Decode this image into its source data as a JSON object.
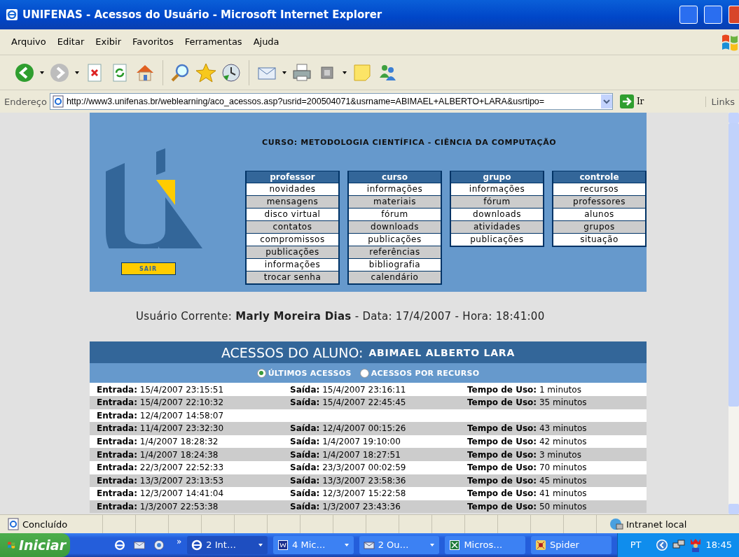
{
  "window": {
    "title": "UNIFENAS - Acessos do Usuário - Microsoft Internet Explorer"
  },
  "menu": [
    "Arquivo",
    "Editar",
    "Exibir",
    "Favoritos",
    "Ferramentas",
    "Ajuda"
  ],
  "address": {
    "label": "Endereço",
    "url": "http://www3.unifenas.br/weblearning/aco_acessos.asp?usrid=200504071&usrname=ABIMAEL+ALBERTO+LARA&usrtipo=",
    "go": "Ir",
    "links": "Links"
  },
  "banner": {
    "course": "CURSO: METODOLOGIA CIENTÍFICA - CIÊNCIA DA COMPUTAÇÃO",
    "exit": "SAIR",
    "menus": [
      {
        "title": "professor",
        "items": [
          "novidades",
          "mensagens",
          "disco virtual",
          "contatos",
          "compromissos",
          "publicações",
          "informações",
          "trocar senha"
        ]
      },
      {
        "title": "curso",
        "items": [
          "informações",
          "materiais",
          "fórum",
          "downloads",
          "publicações",
          "referências",
          "bibliografia",
          "calendário"
        ]
      },
      {
        "title": "grupo",
        "items": [
          "informações",
          "fórum",
          "downloads",
          "atividades",
          "publicações"
        ]
      },
      {
        "title": "controle",
        "items": [
          "recursos",
          "professores",
          "alunos",
          "grupos",
          "situação"
        ]
      }
    ]
  },
  "current_user": "Usuário Corrente: **Marly Moreira Dias** - Data: 17/4/2007 - Hora: 18:41:00",
  "access": {
    "title": "ACESSOS DO ALUNO:",
    "student": "ABIMAEL ALBERTO LARA",
    "radios": [
      {
        "label": "ÚLTIMOS ACESSOS",
        "selected": true
      },
      {
        "label": "ACESSOS POR RECURSO",
        "selected": false
      }
    ],
    "rows": [
      {
        "entrada": "**Entrada:** 15/4/2007 23:15:51",
        "saida": "**Saída:** 15/4/2007 23:16:11",
        "tempo": "**Tempo de Uso:** 1 minutos"
      },
      {
        "entrada": "**Entrada:** 15/4/2007 22:10:32",
        "saida": "**Saída:** 15/4/2007 22:45:45",
        "tempo": "**Tempo de Uso:** 35 minutos"
      },
      {
        "entrada": "**Entrada:** 12/4/2007 14:58:07"
      },
      {
        "entrada": "**Entrada:** 11/4/2007 23:32:30",
        "saida": "**Saída:** 12/4/2007 00:15:26",
        "tempo": "**Tempo de Uso:** 43 minutos"
      },
      {
        "entrada": "**Entrada:** 1/4/2007 18:28:32",
        "saida": "**Saída:** 1/4/2007 19:10:00",
        "tempo": "**Tempo de Uso:** 42 minutos"
      },
      {
        "entrada": "**Entrada:** 1/4/2007 18:24:38",
        "saida": "**Saída:** 1/4/2007 18:27:51",
        "tempo": "**Tempo de Uso:** 3 minutos"
      },
      {
        "entrada": "**Entrada:** 22/3/2007 22:52:33",
        "saida": "**Saída:** 23/3/2007 00:02:59",
        "tempo": "**Tempo de Uso:** 70 minutos"
      },
      {
        "entrada": "**Entrada:** 13/3/2007 23:13:53",
        "saida": "**Saída:** 13/3/2007 23:58:36",
        "tempo": "**Tempo de Uso:** 45 minutos"
      },
      {
        "entrada": "**Entrada:** 12/3/2007 14:41:04",
        "saida": "**Saída:** 12/3/2007 15:22:58",
        "tempo": "**Tempo de Uso:** 41 minutos"
      },
      {
        "entrada": "**Entrada:** 1/3/2007 22:53:38",
        "saida": "**Saída:** 1/3/2007 23:43:36",
        "tempo": "**Tempo de Uso:** 50 minutos"
      }
    ]
  },
  "status_bar": {
    "text": "Concluído",
    "zone": "Intranet local"
  },
  "taskbar": {
    "start": "Iniciar",
    "more": "»",
    "tasks": [
      {
        "label": "2 Int…",
        "kind": "browser",
        "selected": true,
        "grouped": true
      },
      {
        "label": "4 Mic…",
        "kind": "word",
        "selected": false,
        "grouped": true
      },
      {
        "label": "2 Ou…",
        "kind": "mail",
        "selected": false,
        "grouped": true
      },
      {
        "label": "Micros…",
        "kind": "excel",
        "selected": false,
        "grouped": false
      },
      {
        "label": "Spider",
        "kind": "spider",
        "selected": false,
        "grouped": false
      }
    ],
    "language": "PT",
    "clock": "18:45"
  }
}
